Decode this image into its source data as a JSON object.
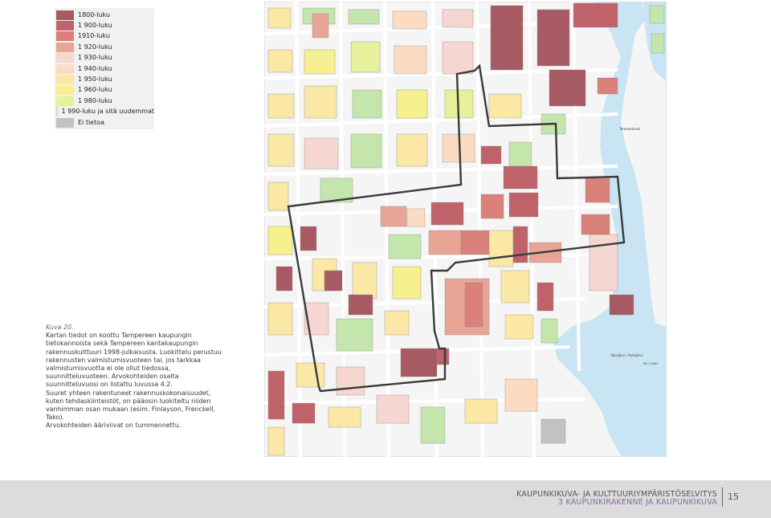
{
  "legend": {
    "items": [
      {
        "label": "1800-luku",
        "color": "#a85a62"
      },
      {
        "label": "1 900-luku",
        "color": "#c0626a"
      },
      {
        "label": "1910-luku",
        "color": "#d9817a"
      },
      {
        "label": "1 920-luku",
        "color": "#e8a595"
      },
      {
        "label": "1 930-luku",
        "color": "#f6d6d0"
      },
      {
        "label": "1 940-luku",
        "color": "#fbdcc3"
      },
      {
        "label": "1 950-luku",
        "color": "#fbe8a6"
      },
      {
        "label": "1 960-luku",
        "color": "#f7f08f"
      },
      {
        "label": "1 980-luku",
        "color": "#e7f09a"
      },
      {
        "label": "1 990-luku ja sitä uudemmat",
        "color": "#c4e6ad"
      },
      {
        "label": "Ei tietoa",
        "color": "#c2c2c2"
      }
    ]
  },
  "caption": {
    "label": "Kuva 20.",
    "text1": "Kartan tiedot on koottu Tampereen kaupungin tietokannoista sekä Tampereen kantakaupungin rakennuskulttuuri 1998-julkaisusta. Luokittelu perustuu rakennusten valmistumisvuoteen tai, jos tarkkaa valmistumisvuotta ei ole ollut tiedossa, suunnitteluvuoteen. Arvokohteiden osalta suunnitteluvuosi on listattu luvussa 4.2.",
    "text2": "Suuret yhteen rakentuneet rakennuskokonaisuudet, kuten tehdaskiinteistöt, on pääosin luokiteltu niiden vanhimman osan mukaan (esim. Finlayson, Frenckell, Tako).",
    "text3": "Arvokohteiden ääriviivat on tummennettu."
  },
  "map": {
    "colors": {
      "water": "#c9e5f4",
      "background": "#f6f6f6",
      "street": "#ffffff",
      "outline": "#3a3a3a"
    },
    "labels": {
      "river": "Tammerkoski",
      "lake": "Näsijärvi / Pyhäjärvi",
      "scale": "Mk 1:4000"
    }
  },
  "footer": {
    "title": "KAUPUNKIKUVA- JA KULTTUURIYMPÄRISTÖSELVITYS",
    "subtitle": "3 KAUPUNKIRAKENNE JA KAUPUNKIKUVA",
    "page": "15"
  }
}
